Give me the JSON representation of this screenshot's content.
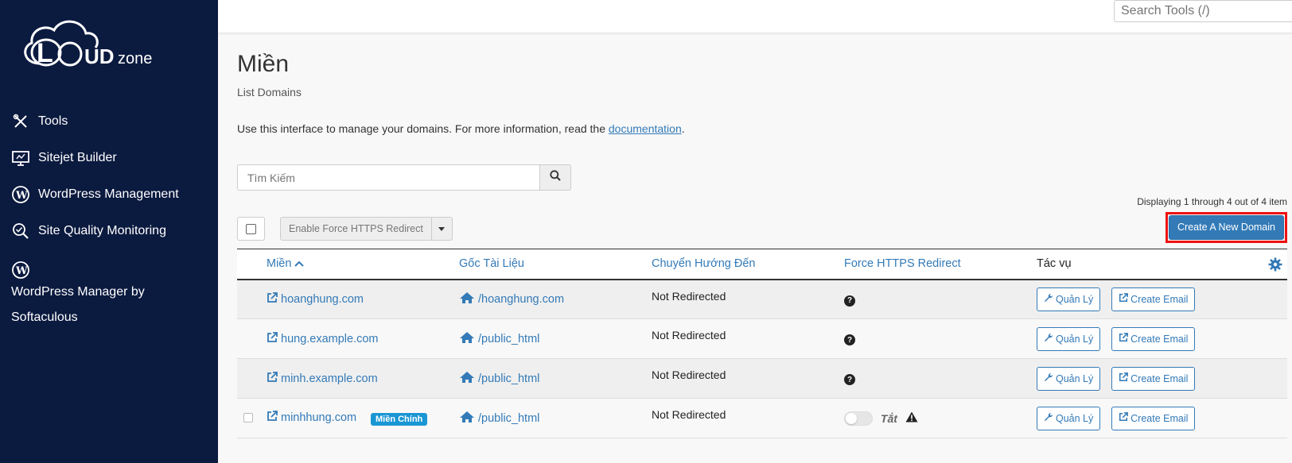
{
  "sidebar": {
    "logo_text": "LOUDzone",
    "items": [
      {
        "label": "Tools",
        "icon": "tools-icon"
      },
      {
        "label": "Sitejet Builder",
        "icon": "monitor-icon"
      },
      {
        "label": "WordPress Management",
        "icon": "wordpress-icon"
      },
      {
        "label": "Site Quality Monitoring",
        "icon": "magnifier-check-icon"
      },
      {
        "label": "WordPress Manager by Softaculous",
        "icon": "wordpress-icon"
      }
    ]
  },
  "topbar": {
    "search_placeholder": "Search Tools (/)"
  },
  "page": {
    "title": "Miền",
    "subtitle": "List Domains",
    "desc_prefix": "Use this interface to manage your domains. For more information, read the ",
    "desc_link": "documentation",
    "desc_suffix": "."
  },
  "search": {
    "placeholder": "Tìm Kiếm"
  },
  "display_count": "Displaying 1 through 4 out of 4 item",
  "bulk_action": {
    "label": "Enable Force HTTPS Redirect"
  },
  "create_button": {
    "label": "Create A New Domain"
  },
  "table": {
    "headers": {
      "domain": "Miền",
      "docroot": "Gốc Tài Liệu",
      "redirect": "Chuyển Hướng Đến",
      "https": "Force HTTPS Redirect",
      "actions": "Tác vụ"
    },
    "rows": [
      {
        "domain": "hoanghung.com",
        "docroot": "/hoanghung.com",
        "redirect": "Not Redirected",
        "https": "?",
        "manage": "Quản Lý",
        "email": "Create Email"
      },
      {
        "domain": "hung.example.com",
        "docroot": "/public_html",
        "redirect": "Not Redirected",
        "https": "?",
        "manage": "Quản Lý",
        "email": "Create Email"
      },
      {
        "domain": "minh.example.com",
        "docroot": "/public_html",
        "redirect": "Not Redirected",
        "https": "?",
        "manage": "Quản Lý",
        "email": "Create Email"
      },
      {
        "domain": "minhhung.com",
        "badge": "Miền Chính",
        "docroot": "/public_html",
        "redirect": "Not Redirected",
        "https_state": "Tắt",
        "manage": "Quản Lý",
        "email": "Create Email"
      }
    ]
  },
  "colors": {
    "sidebar_bg": "#0b1a3f",
    "link": "#337ab7",
    "primary_button": "#337ab7",
    "badge": "#1a96d4",
    "highlight": "#e11111"
  }
}
